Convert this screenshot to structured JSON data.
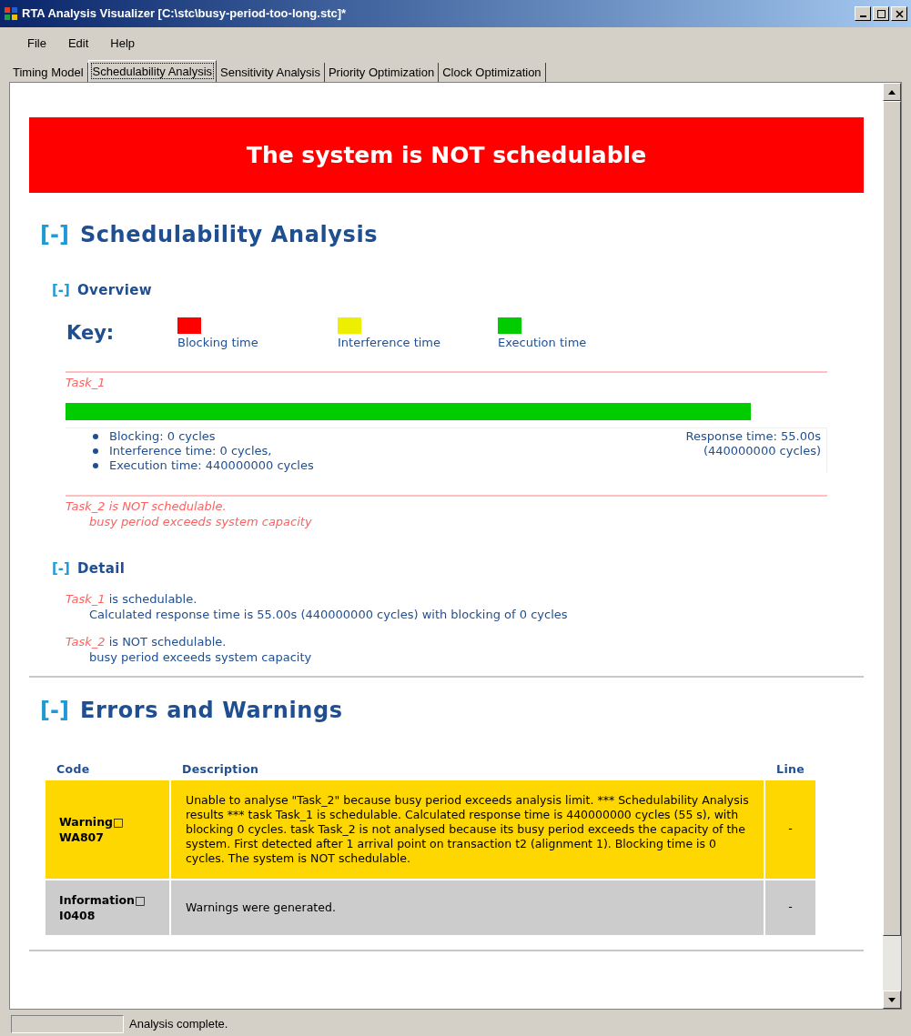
{
  "window": {
    "title": "RTA Analysis Visualizer [C:\\stc\\busy-period-too-long.stc]*"
  },
  "menu": [
    "File",
    "Edit",
    "Help"
  ],
  "tabs": [
    {
      "label": "Timing Model",
      "selected": false
    },
    {
      "label": "Schedulability Analysis",
      "selected": true
    },
    {
      "label": "Sensitivity Analysis",
      "selected": false
    },
    {
      "label": "Priority Optimization",
      "selected": false
    },
    {
      "label": "Clock Optimization",
      "selected": false
    }
  ],
  "banner": {
    "text": "The system is NOT schedulable",
    "schedulable": false
  },
  "section": {
    "toggle": "[-]",
    "title": "Schedulability Analysis"
  },
  "overview": {
    "toggle": "[-]",
    "title": "Overview",
    "key_label": "Key:",
    "key": [
      {
        "label": "Blocking time",
        "color": "#ff0000"
      },
      {
        "label": "Interference time",
        "color": "#eeee00"
      },
      {
        "label": "Execution time",
        "color": "#00cc00"
      }
    ],
    "task": {
      "name": "Task_1",
      "level": 0.9,
      "color": "#00cc00",
      "bullets": [
        "Blocking: 0 cycles",
        "Interference time: 0 cycles,",
        "Execution time: 440000000 cycles"
      ],
      "response": [
        "Response time: 55.00s",
        "(440000000 cycles)"
      ]
    },
    "failed": {
      "text": "Task_2 is NOT schedulable.",
      "reason": "busy period exceeds system capacity"
    }
  },
  "detail": {
    "toggle": "[-]",
    "title": "Detail",
    "items": [
      {
        "task": "Task_1",
        "status": "is schedulable.",
        "note": "Calculated response time is 55.00s (440000000 cycles) with blocking of 0 cycles"
      },
      {
        "task": "Task_2",
        "status": "is NOT schedulable.",
        "note": "busy period exceeds system capacity"
      }
    ]
  },
  "errors": {
    "toggle": "[-]",
    "title": "Errors and Warnings",
    "columns": [
      "Code",
      "Description",
      "Line"
    ],
    "rows": [
      {
        "kind": "warning",
        "code": "Warning□",
        "number": "WA807",
        "description": "Unable to analyse \"Task_2\" because busy period exceeds analysis limit. *** Schedulability Analysis results *** task Task_1 is schedulable. Calculated response time is 440000000 cycles (55 s), with blocking 0 cycles. task Task_2 is not analysed because its busy period exceeds the capacity of the system. First detected after 1 arrival point on transaction t2 (alignment 1). Blocking time is 0 cycles. The system is NOT schedulable.",
        "line": "-"
      },
      {
        "kind": "information",
        "code": "Information□",
        "number": "I0408",
        "description": "Warnings were generated.",
        "line": "-"
      }
    ]
  },
  "status_bar": {
    "text": "Analysis complete."
  }
}
